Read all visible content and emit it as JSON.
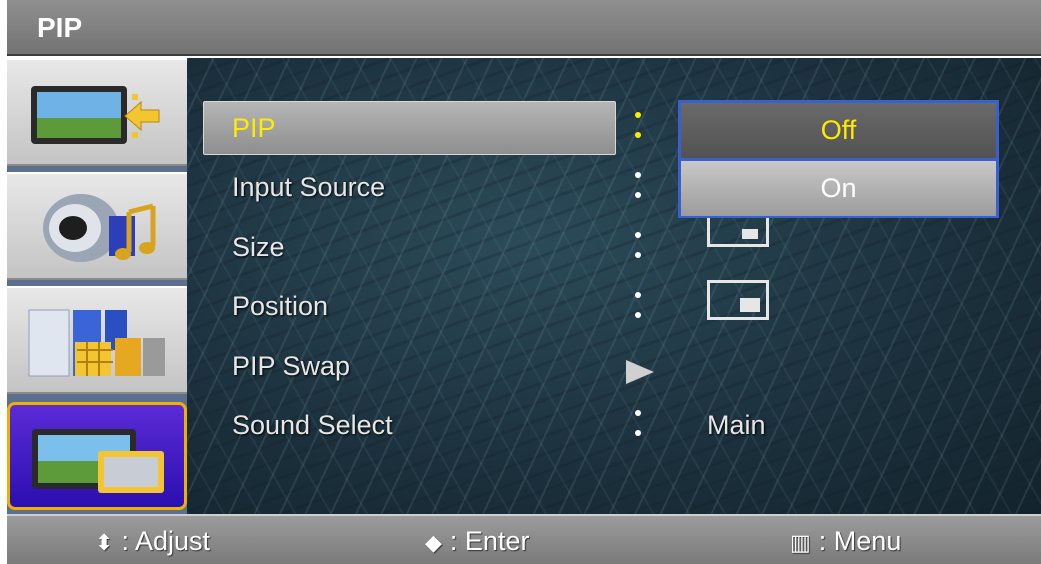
{
  "window": {
    "title": "PIP"
  },
  "sidebar": {
    "tabs": [
      {
        "icon": "picture-icon",
        "active": false
      },
      {
        "icon": "sound-icon",
        "active": false
      },
      {
        "icon": "channel-icon",
        "active": false
      },
      {
        "icon": "setup-icon",
        "active": true
      }
    ]
  },
  "menu": {
    "items": [
      {
        "label": "PIP",
        "separator": ":"
      },
      {
        "label": "Input Source",
        "separator": ":"
      },
      {
        "label": "Size",
        "separator": ":"
      },
      {
        "label": "Position",
        "separator": ":"
      },
      {
        "label": "PIP Swap",
        "separator": "▶"
      },
      {
        "label": "Sound Select",
        "separator": ":",
        "value": "Main"
      }
    ]
  },
  "dropdown": {
    "options": [
      "Off",
      "On"
    ],
    "selected": "Off"
  },
  "footer": {
    "adjust_symbol": "⬍",
    "adjust_label": ": Adjust",
    "enter_symbol": "◆",
    "enter_label": ": Enter",
    "menu_symbol": "▥",
    "menu_label": ": Menu"
  },
  "colors": {
    "highlight_text": "#ffeb00",
    "dropdown_border": "#3a5fd0",
    "active_tab": "#2b0fb0"
  }
}
